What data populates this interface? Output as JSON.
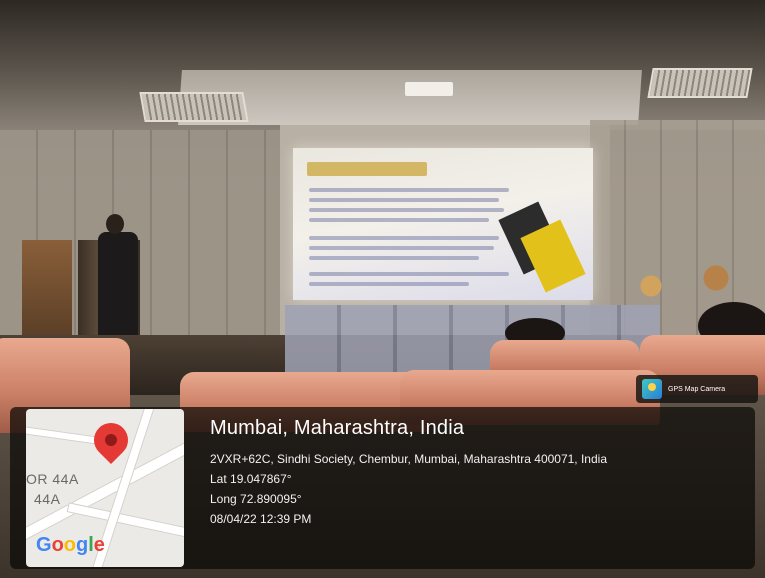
{
  "badge": {
    "label": "GPS Map Camera",
    "icon": "gps-map-camera-icon"
  },
  "map": {
    "road_labels": [
      "OR 44A",
      "44A"
    ],
    "logo_text": "Google",
    "pin_icon": "map-pin-icon",
    "pin_color": "#e53935"
  },
  "location": {
    "title": "Mumbai, Maharashtra, India",
    "address": "2VXR+62C, Sindhi Society, Chembur, Mumbai, Maharashtra 400071, India",
    "latitude": "Lat 19.047867°",
    "longitude": "Long 72.890095°",
    "datetime": "08/04/22 12:39 PM"
  }
}
